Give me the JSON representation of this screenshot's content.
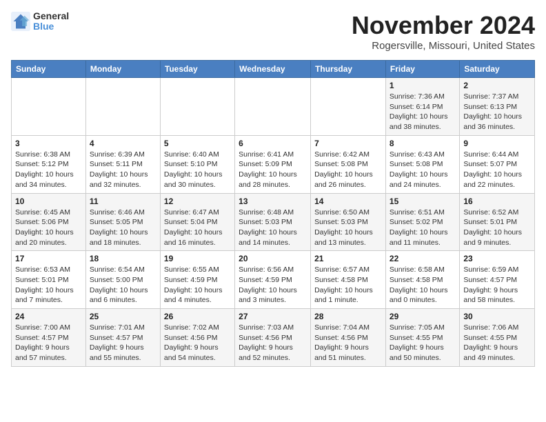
{
  "header": {
    "logo_general": "General",
    "logo_blue": "Blue",
    "month": "November 2024",
    "location": "Rogersville, Missouri, United States"
  },
  "days_of_week": [
    "Sunday",
    "Monday",
    "Tuesday",
    "Wednesday",
    "Thursday",
    "Friday",
    "Saturday"
  ],
  "weeks": [
    [
      {
        "day": "",
        "info": ""
      },
      {
        "day": "",
        "info": ""
      },
      {
        "day": "",
        "info": ""
      },
      {
        "day": "",
        "info": ""
      },
      {
        "day": "",
        "info": ""
      },
      {
        "day": "1",
        "info": "Sunrise: 7:36 AM\nSunset: 6:14 PM\nDaylight: 10 hours and 38 minutes."
      },
      {
        "day": "2",
        "info": "Sunrise: 7:37 AM\nSunset: 6:13 PM\nDaylight: 10 hours and 36 minutes."
      }
    ],
    [
      {
        "day": "3",
        "info": "Sunrise: 6:38 AM\nSunset: 5:12 PM\nDaylight: 10 hours and 34 minutes."
      },
      {
        "day": "4",
        "info": "Sunrise: 6:39 AM\nSunset: 5:11 PM\nDaylight: 10 hours and 32 minutes."
      },
      {
        "day": "5",
        "info": "Sunrise: 6:40 AM\nSunset: 5:10 PM\nDaylight: 10 hours and 30 minutes."
      },
      {
        "day": "6",
        "info": "Sunrise: 6:41 AM\nSunset: 5:09 PM\nDaylight: 10 hours and 28 minutes."
      },
      {
        "day": "7",
        "info": "Sunrise: 6:42 AM\nSunset: 5:08 PM\nDaylight: 10 hours and 26 minutes."
      },
      {
        "day": "8",
        "info": "Sunrise: 6:43 AM\nSunset: 5:08 PM\nDaylight: 10 hours and 24 minutes."
      },
      {
        "day": "9",
        "info": "Sunrise: 6:44 AM\nSunset: 5:07 PM\nDaylight: 10 hours and 22 minutes."
      }
    ],
    [
      {
        "day": "10",
        "info": "Sunrise: 6:45 AM\nSunset: 5:06 PM\nDaylight: 10 hours and 20 minutes."
      },
      {
        "day": "11",
        "info": "Sunrise: 6:46 AM\nSunset: 5:05 PM\nDaylight: 10 hours and 18 minutes."
      },
      {
        "day": "12",
        "info": "Sunrise: 6:47 AM\nSunset: 5:04 PM\nDaylight: 10 hours and 16 minutes."
      },
      {
        "day": "13",
        "info": "Sunrise: 6:48 AM\nSunset: 5:03 PM\nDaylight: 10 hours and 14 minutes."
      },
      {
        "day": "14",
        "info": "Sunrise: 6:50 AM\nSunset: 5:03 PM\nDaylight: 10 hours and 13 minutes."
      },
      {
        "day": "15",
        "info": "Sunrise: 6:51 AM\nSunset: 5:02 PM\nDaylight: 10 hours and 11 minutes."
      },
      {
        "day": "16",
        "info": "Sunrise: 6:52 AM\nSunset: 5:01 PM\nDaylight: 10 hours and 9 minutes."
      }
    ],
    [
      {
        "day": "17",
        "info": "Sunrise: 6:53 AM\nSunset: 5:01 PM\nDaylight: 10 hours and 7 minutes."
      },
      {
        "day": "18",
        "info": "Sunrise: 6:54 AM\nSunset: 5:00 PM\nDaylight: 10 hours and 6 minutes."
      },
      {
        "day": "19",
        "info": "Sunrise: 6:55 AM\nSunset: 4:59 PM\nDaylight: 10 hours and 4 minutes."
      },
      {
        "day": "20",
        "info": "Sunrise: 6:56 AM\nSunset: 4:59 PM\nDaylight: 10 hours and 3 minutes."
      },
      {
        "day": "21",
        "info": "Sunrise: 6:57 AM\nSunset: 4:58 PM\nDaylight: 10 hours and 1 minute."
      },
      {
        "day": "22",
        "info": "Sunrise: 6:58 AM\nSunset: 4:58 PM\nDaylight: 10 hours and 0 minutes."
      },
      {
        "day": "23",
        "info": "Sunrise: 6:59 AM\nSunset: 4:57 PM\nDaylight: 9 hours and 58 minutes."
      }
    ],
    [
      {
        "day": "24",
        "info": "Sunrise: 7:00 AM\nSunset: 4:57 PM\nDaylight: 9 hours and 57 minutes."
      },
      {
        "day": "25",
        "info": "Sunrise: 7:01 AM\nSunset: 4:57 PM\nDaylight: 9 hours and 55 minutes."
      },
      {
        "day": "26",
        "info": "Sunrise: 7:02 AM\nSunset: 4:56 PM\nDaylight: 9 hours and 54 minutes."
      },
      {
        "day": "27",
        "info": "Sunrise: 7:03 AM\nSunset: 4:56 PM\nDaylight: 9 hours and 52 minutes."
      },
      {
        "day": "28",
        "info": "Sunrise: 7:04 AM\nSunset: 4:56 PM\nDaylight: 9 hours and 51 minutes."
      },
      {
        "day": "29",
        "info": "Sunrise: 7:05 AM\nSunset: 4:55 PM\nDaylight: 9 hours and 50 minutes."
      },
      {
        "day": "30",
        "info": "Sunrise: 7:06 AM\nSunset: 4:55 PM\nDaylight: 9 hours and 49 minutes."
      }
    ]
  ]
}
